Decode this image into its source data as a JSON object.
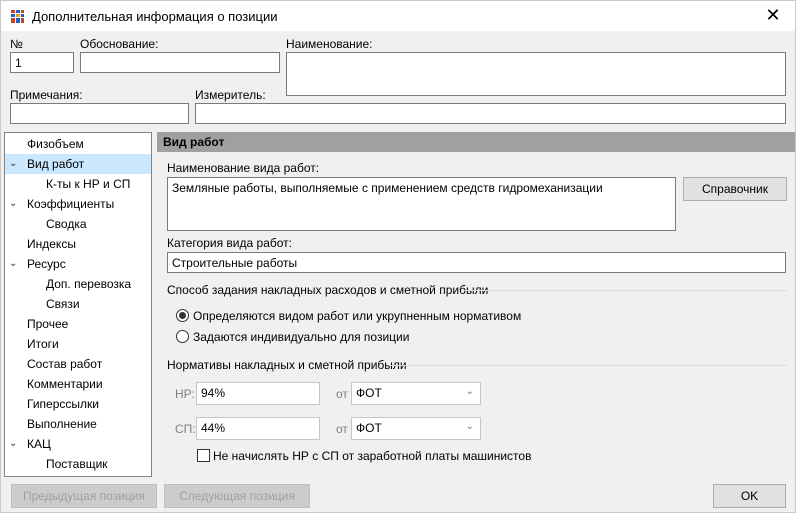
{
  "window": {
    "title": "Дополнительная информация о позиции",
    "close_glyph": "✕"
  },
  "header": {
    "number_label": "№",
    "number_value": "1",
    "basis_label": "Обоснование:",
    "basis_value": "",
    "name_label": "Наименование:",
    "name_value": "",
    "notes_label": "Примечания:",
    "notes_value": "",
    "unit_label": "Измеритель:",
    "unit_value": ""
  },
  "tree": {
    "items": [
      {
        "label": "Физобъем"
      },
      {
        "label": "Вид работ"
      },
      {
        "label": "К-ты к НР и СП"
      },
      {
        "label": "Коэффициенты"
      },
      {
        "label": "Сводка"
      },
      {
        "label": "Индексы"
      },
      {
        "label": "Ресурс"
      },
      {
        "label": "Доп. перевозка"
      },
      {
        "label": "Связи"
      },
      {
        "label": "Прочее"
      },
      {
        "label": "Итоги"
      },
      {
        "label": "Состав работ"
      },
      {
        "label": "Комментарии"
      },
      {
        "label": "Гиперссылки"
      },
      {
        "label": "Выполнение"
      },
      {
        "label": "КАЦ"
      },
      {
        "label": "Поставщик"
      }
    ]
  },
  "panel": {
    "header": "Вид работ",
    "work_type_name_label": "Наименование вида работ:",
    "work_type_name_value": "Земляные работы, выполняемые с применением средств гидромеханизации",
    "reference_button": "Справочник",
    "category_label": "Категория вида работ:",
    "category_value": "Строительные работы",
    "method_section": "Способ задания накладных расходов и сметной прибыли",
    "radio_by_type": "Определяются видом работ или укрупненным нормативом",
    "radio_individual": "Задаются индивидуально для позиции",
    "norms_section": "Нормативы накладных  и сметной прибыли",
    "nr_label": "НР:",
    "nr_value": "94%",
    "nr_from": "от",
    "nr_base": "ФОТ",
    "sp_label": "СП:",
    "sp_value": "44%",
    "sp_from": "от",
    "sp_base": "ФОТ",
    "checkbox_label": "Не начислять НР с СП от заработной платы машинистов"
  },
  "footer": {
    "prev_button": "Предыдущая позиция",
    "next_button": "Следующая позиция",
    "ok_button": "OK"
  }
}
